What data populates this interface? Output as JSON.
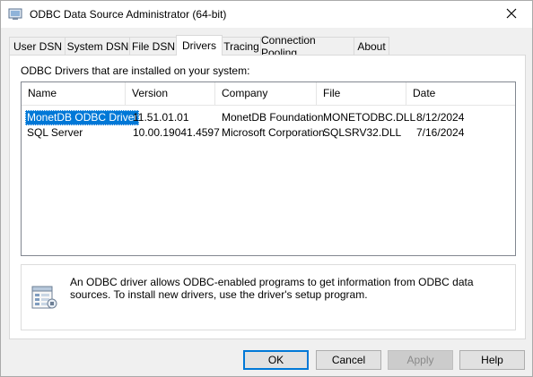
{
  "window": {
    "title": "ODBC Data Source Administrator (64-bit)"
  },
  "tabs": [
    {
      "label": "User DSN"
    },
    {
      "label": "System DSN"
    },
    {
      "label": "File DSN"
    },
    {
      "label": "Drivers",
      "active": true
    },
    {
      "label": "Tracing"
    },
    {
      "label": "Connection Pooling"
    },
    {
      "label": "About"
    }
  ],
  "drivers": {
    "label": "ODBC Drivers that are installed on your system:",
    "columns": [
      "Name",
      "Version",
      "Company",
      "File",
      "Date"
    ],
    "rows": [
      {
        "name": "MonetDB ODBC Driver",
        "version": "11.51.01.01",
        "company": "MonetDB Foundation",
        "file": "MONETODBC.DLL",
        "date": "8/12/2024",
        "selected": true
      },
      {
        "name": "SQL Server",
        "version": "10.00.19041.4597",
        "company": "Microsoft Corporation",
        "file": "SQLSRV32.DLL",
        "date": "7/16/2024"
      }
    ]
  },
  "info": {
    "text": "An ODBC driver allows ODBC-enabled programs to get information from ODBC data sources.  To install new drivers, use the driver's setup program.",
    "icon": "odbc-driver-icon"
  },
  "buttons": {
    "ok": "OK",
    "cancel": "Cancel",
    "apply": "Apply",
    "help": "Help"
  },
  "colors": {
    "selection": "#0078d7",
    "default_button_border": "#0078d7"
  }
}
